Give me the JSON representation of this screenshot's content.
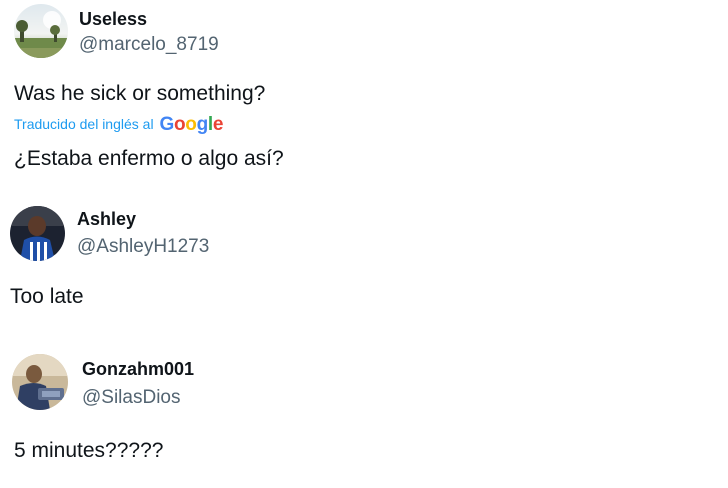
{
  "replies": [
    {
      "display_name": "Useless",
      "handle": "@marcelo_8719",
      "text": "Was he sick or something?",
      "translation": {
        "label": "Traducido del inglés al",
        "provider": "Google",
        "text": "¿Estaba enfermo o algo así?"
      }
    },
    {
      "display_name": "Ashley",
      "handle": "@AshleyH1273",
      "text": "Too late"
    },
    {
      "display_name": "Gonzahm001",
      "handle": "@SilasDios",
      "text": "5 minutes?????"
    }
  ],
  "colors": {
    "text_primary": "#0f1419",
    "text_secondary": "#536471",
    "link_blue": "#1d9bf0"
  }
}
